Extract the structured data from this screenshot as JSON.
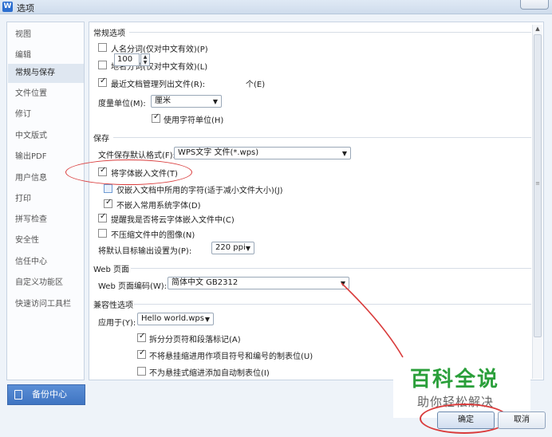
{
  "window": {
    "title": "选项",
    "app_icon_letter": "W"
  },
  "sidebar": {
    "items": [
      {
        "label": "视图"
      },
      {
        "label": "编辑"
      },
      {
        "label": "常规与保存",
        "active": true
      },
      {
        "label": "文件位置"
      },
      {
        "label": "修订"
      },
      {
        "label": "中文版式"
      },
      {
        "label": "输出PDF"
      },
      {
        "label": "用户信息"
      },
      {
        "label": "打印"
      },
      {
        "label": "拼写检查"
      },
      {
        "label": "安全性"
      },
      {
        "label": "信任中心"
      },
      {
        "label": "自定义功能区"
      },
      {
        "label": "快速访问工具栏"
      }
    ],
    "backup_label": "备份中心"
  },
  "general": {
    "heading": "常规选项",
    "name_seg": "人名分词(仅对中文有效)(P)",
    "place_seg": "地名分词(仅对中文有效)(L)",
    "recent_files": "最近文档管理列出文件(R):",
    "recent_count": "100",
    "recent_unit": "个(E)",
    "unit_label": "度量单位(M):",
    "unit_value": "厘米",
    "use_char_unit": "使用字符单位(H)"
  },
  "save": {
    "heading": "保存",
    "format_label": "文件保存默认格式(F):",
    "format_value": "WPS文字 文件(*.wps)",
    "embed_fonts": "将字体嵌入文件(T)",
    "embed_used_only": "仅嵌入文档中所用的字符(适于减小文件大小)(J)",
    "no_system_fonts": "不嵌入常用系统字体(D)",
    "remind_cloud": "提醒我是否将云字体嵌入文件中(C)",
    "no_compress": "不压缩文件中的图像(N)",
    "ppi_label": "将默认目标输出设置为(P):",
    "ppi_value": "220 ppi"
  },
  "web": {
    "heading": "Web 页面",
    "encoding_label": "Web 页面编码(W):",
    "encoding_value": "简体中文 GB2312"
  },
  "compat": {
    "heading": "兼容性选项",
    "apply_label": "应用于(Y):",
    "apply_value": "Hello world.wps",
    "split_page": "拆分分页符和段落标记(A)",
    "no_hanging": "不将悬挂缩进用作项目符号和编号的制表位(U)",
    "no_auto_tab": "不为悬挂式缩进添加自动制表位(I)"
  },
  "watermark": {
    "title": "百科全说",
    "subtitle": "助你轻松解决"
  },
  "buttons": {
    "ok": "确定",
    "cancel": "取消"
  },
  "colors": {
    "accent_blue": "#3f74c2",
    "annotation_red": "#d93b3b",
    "watermark_green": "#2a9f3a"
  }
}
